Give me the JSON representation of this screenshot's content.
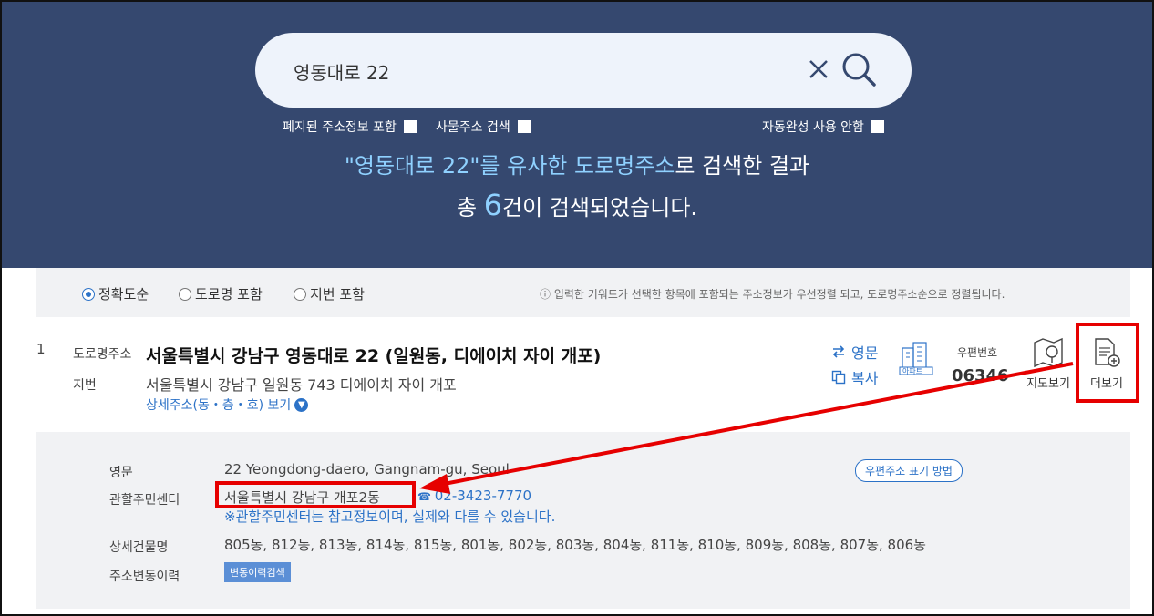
{
  "search": {
    "query": "영동대로 22",
    "options": [
      {
        "label": "폐지된 주소정보 포함",
        "checked": false
      },
      {
        "label": "사물주소 검색",
        "checked": false
      },
      {
        "label": "자동완성 사용 안함",
        "checked": false
      }
    ],
    "result_line1_highlight": "\"영동대로 22\"를 유사한 도로명주소",
    "result_line1_rest": "로 검색한 결과",
    "result_line2_prefix": "총 ",
    "result_count": "6",
    "result_line2_suffix": "건이 검색되었습니다."
  },
  "sort": {
    "options": [
      {
        "label": "정확도순",
        "selected": true
      },
      {
        "label": "도로명 포함",
        "selected": false
      },
      {
        "label": "지번 포함",
        "selected": false
      }
    ],
    "note": "ⓘ 입력한 키워드가 선택한 항목에 포함되는 주소정보가 우선정렬 되고, 도로명주소순으로 정렬됩니다."
  },
  "result": {
    "index": "1",
    "road_label": "도로명주소",
    "road_address": "서울특별시 강남구 영동대로 22 (일원동, 디에이치 자이 개포)",
    "jibun_label": "지번",
    "jibun_address": "서울특별시 강남구 일원동 743 디에이치 자이 개포",
    "detail_link": "상세주소(동・층・호) 보기",
    "english_button": "영문",
    "copy_button": "복사",
    "apartment_badge": "아파트",
    "zip_label": "우편번호",
    "zip_code": "06346",
    "map_button": "지도보기",
    "more_button": "더보기"
  },
  "details": {
    "english_label": "영문",
    "english_value": "22 Yeongdong-daero, Gangnam-gu, Seoul",
    "postal_method": "우편주소 표기 방법",
    "center_label": "관할주민센터",
    "center_value": "서울특별시 강남구 개포2동",
    "phone": "02-3423-7770",
    "note": "※관할주민센터는 참고정보이며, 실제와 다를 수 있습니다.",
    "buildings_label": "상세건물명",
    "buildings_value": "805동, 812동, 813동, 814동, 815동, 801동, 802동, 803동, 804동, 811동, 810동, 809동, 808동, 807동, 806동",
    "history_label": "주소변동이력",
    "history_button": "변동이력검색"
  },
  "colors": {
    "hero_bg": "#35486f",
    "accent_blue": "#2c72c7",
    "annotation_red": "#e60000"
  }
}
